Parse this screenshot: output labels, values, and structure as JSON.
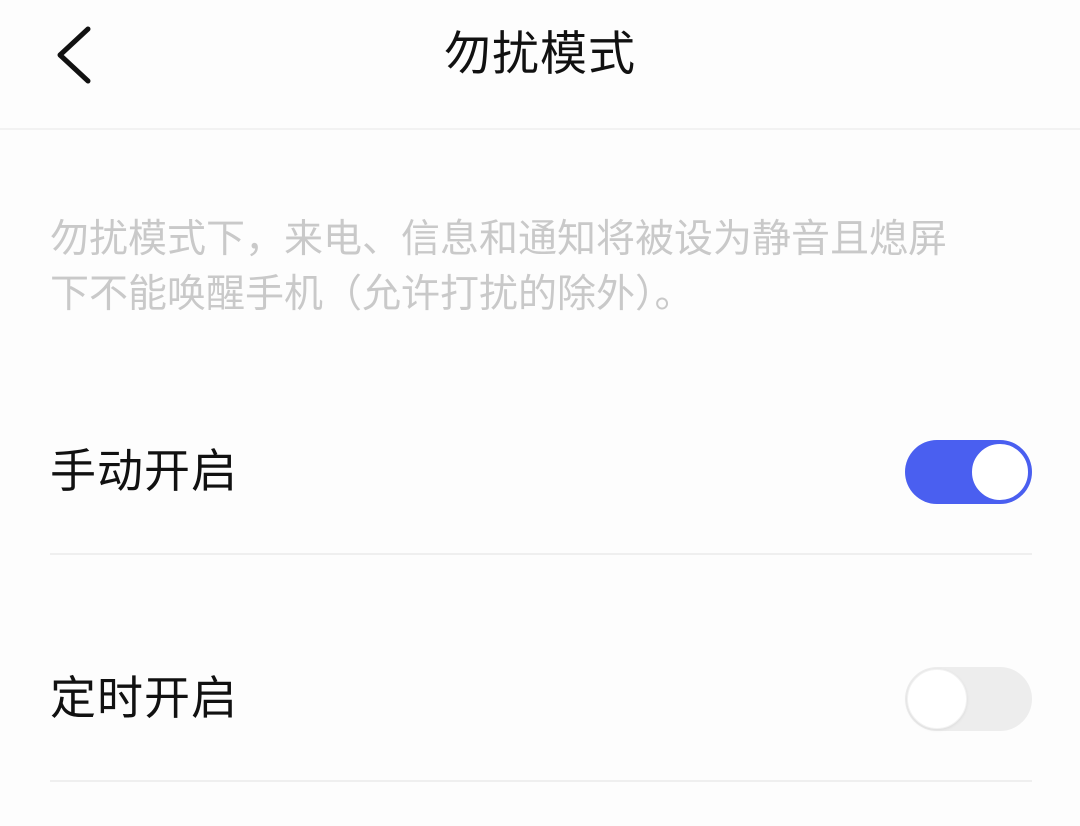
{
  "header": {
    "title": "勿扰模式",
    "back_icon": "chevron-left-icon"
  },
  "description": {
    "lines": [
      "勿扰模式下，来电、信息和通知将被设为静音且熄屏",
      "下不能唤醒手机（允许打扰的除外）。"
    ]
  },
  "settings": [
    {
      "label": "手动开启",
      "enabled": true
    },
    {
      "label": "定时开启",
      "enabled": false
    }
  ],
  "colors": {
    "toggle_on": "#4a5ff0",
    "toggle_off": "#ededed",
    "description_text": "#c9c9c9"
  }
}
